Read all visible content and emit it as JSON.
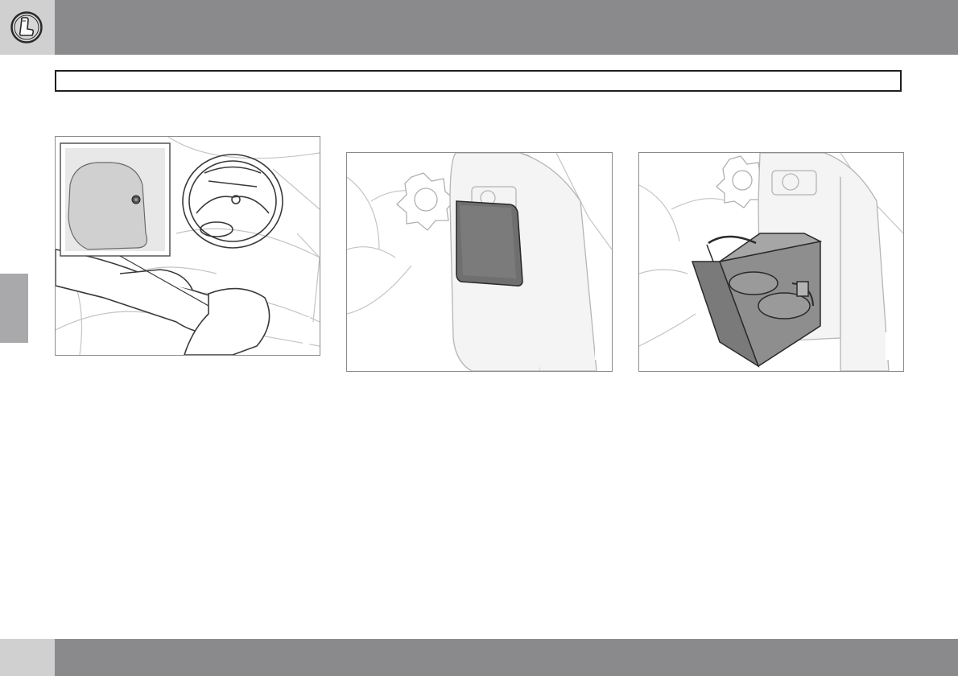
{
  "header": {
    "chapter_icon": "car-seat-icon",
    "chapter_icon_color": "#2a2a2a",
    "bar_color": "#8a8a8d"
  },
  "illustrations": [
    {
      "name": "steering-wheel-headrest-illustration"
    },
    {
      "name": "center-console-closed-illustration"
    },
    {
      "name": "cup-holder-open-illustration"
    }
  ],
  "footer": {
    "bar_color": "#8a8a8d"
  }
}
